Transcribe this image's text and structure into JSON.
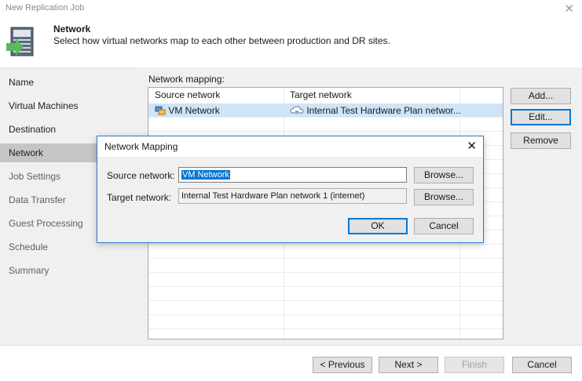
{
  "window": {
    "title": "New Replication Job",
    "close_glyph": "✕"
  },
  "header": {
    "title": "Network",
    "subtitle": "Select how virtual networks map to each other between production and DR sites.",
    "icon": "network-wizard-icon"
  },
  "sidebar": {
    "items": [
      {
        "label": "Name",
        "state": "normal"
      },
      {
        "label": "Virtual Machines",
        "state": "normal"
      },
      {
        "label": "Destination",
        "state": "normal"
      },
      {
        "label": "Network",
        "state": "active"
      },
      {
        "label": "Job Settings",
        "state": "muted"
      },
      {
        "label": "Data Transfer",
        "state": "muted"
      },
      {
        "label": "Guest Processing",
        "state": "muted"
      },
      {
        "label": "Schedule",
        "state": "muted"
      },
      {
        "label": "Summary",
        "state": "muted"
      }
    ]
  },
  "network_mapping": {
    "label": "Network mapping:",
    "columns": [
      "Source network",
      "Target network"
    ],
    "rows": [
      {
        "source": "VM Network",
        "target": "Internal Test Hardware Plan networ..."
      }
    ]
  },
  "side_buttons": {
    "add": "Add...",
    "edit": "Edit...",
    "remove": "Remove"
  },
  "dialog": {
    "title": "Network Mapping",
    "close_glyph": "✕",
    "source_label": "Source network:",
    "source_value": "VM Network",
    "target_label": "Target network:",
    "target_value": "Internal Test Hardware Plan network 1 (internet)",
    "browse": "Browse...",
    "ok": "OK",
    "cancel": "Cancel"
  },
  "footer": {
    "previous": "< Previous",
    "next": "Next >",
    "finish": "Finish",
    "cancel": "Cancel"
  },
  "colors": {
    "accent": "#0078d7",
    "selection": "#cfe4f7",
    "sidebar_active": "#c5c5c5",
    "arrow_green": "#5cb85c"
  }
}
